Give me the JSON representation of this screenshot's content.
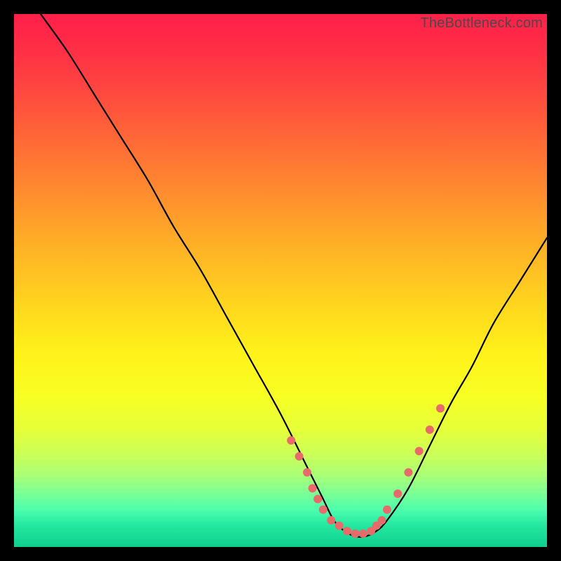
{
  "watermark": "TheBottleneck.com",
  "chart_data": {
    "type": "line",
    "title": "",
    "xlabel": "",
    "ylabel": "",
    "xlim": [
      0,
      100
    ],
    "ylim": [
      0,
      100
    ],
    "grid": false,
    "legend": false,
    "curve_color": "#000000",
    "marker_color": "#e96a6a",
    "gradient_stops": [
      {
        "pos": 0,
        "color": "#ff1f4a"
      },
      {
        "pos": 50,
        "color": "#ffe11c"
      },
      {
        "pos": 100,
        "color": "#0fd08e"
      }
    ],
    "series": [
      {
        "name": "bottleneck-curve",
        "x": [
          5,
          10,
          15,
          20,
          25,
          30,
          35,
          40,
          45,
          50,
          55,
          58,
          60,
          62,
          64,
          66,
          68,
          70,
          74,
          78,
          82,
          86,
          90,
          95,
          100
        ],
        "y": [
          100,
          93,
          85,
          77,
          69,
          60,
          52,
          43,
          34,
          25,
          15,
          9,
          5,
          3,
          2,
          2,
          3,
          5,
          11,
          19,
          27,
          34,
          42,
          50,
          58
        ]
      }
    ],
    "markers": {
      "name": "highlight-dots",
      "x": [
        52,
        53.5,
        55,
        56,
        57,
        58,
        59.5,
        61,
        62.5,
        64,
        65.5,
        67,
        68,
        69,
        70,
        72,
        74,
        76,
        78,
        80
      ],
      "y": [
        20,
        17,
        14,
        11,
        9,
        7,
        5,
        4,
        3,
        2.5,
        2.5,
        3,
        4,
        5,
        7,
        10,
        14,
        18,
        22,
        26
      ]
    }
  }
}
